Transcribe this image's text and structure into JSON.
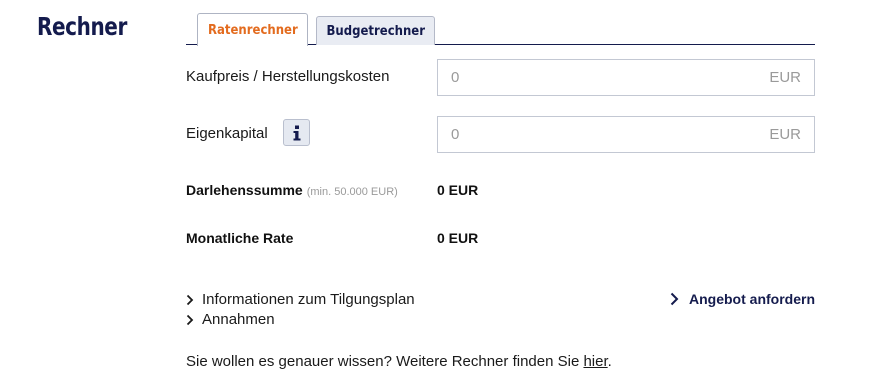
{
  "page": {
    "title": "Rechner"
  },
  "tabs": [
    {
      "label": "Ratenrechner",
      "active": true
    },
    {
      "label": "Budgetrechner",
      "active": false
    }
  ],
  "fields": {
    "kaufpreis": {
      "label": "Kaufpreis / Herstellungskosten",
      "placeholder": "0",
      "value": "",
      "unit": "EUR"
    },
    "eigenkapital": {
      "label": "Eigenkapital",
      "placeholder": "0",
      "value": "",
      "unit": "EUR",
      "info_icon": "info-icon"
    }
  },
  "results": {
    "darlehen": {
      "label": "Darlehenssumme",
      "note": "(min. 50.000 EUR)",
      "value": "0 EUR"
    },
    "rate": {
      "label": "Monatliche Rate",
      "value": "0 EUR"
    }
  },
  "links": {
    "tilgungsplan": "Informationen zum Tilgungsplan",
    "annahmen": "Annahmen",
    "angebot": "Angebot anfordern"
  },
  "footer": {
    "text": "Sie wollen es genauer wissen? Weitere Rechner finden Sie ",
    "link": "hier",
    "suffix": "."
  },
  "colors": {
    "brand": "#141b4d",
    "accent": "#e36b1e",
    "border": "#c3c8d3",
    "muted": "#9a9a9a"
  }
}
